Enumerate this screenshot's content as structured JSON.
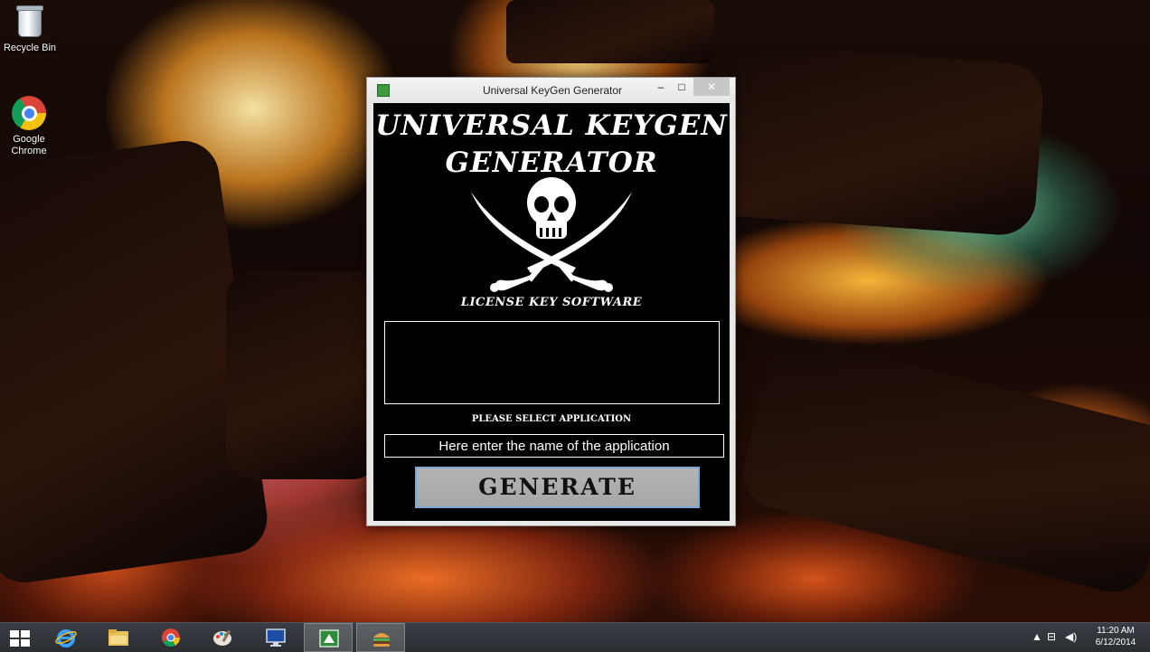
{
  "desktop": {
    "icons": [
      {
        "label": "Recycle Bin",
        "icon": "recycle-bin-icon"
      },
      {
        "label": "Google Chrome",
        "icon": "chrome-icon"
      }
    ]
  },
  "window": {
    "title": "Universal KeyGen Generator",
    "controls": {
      "minimize": "–",
      "maximize": "□",
      "close": "✕"
    },
    "header_line1": "UNIVERSAL KEYGEN",
    "header_line2": "GENERATOR",
    "logo": "skull-crossed-swords-icon",
    "tagline": "LICENSE KEY SOFTWARE",
    "output_value": "",
    "select_label": "PLEASE SELECT APPLICATION",
    "app_input": {
      "placeholder": "Here enter the name of the application",
      "value": ""
    },
    "generate_label": "GENERATE"
  },
  "taskbar": {
    "items": [
      {
        "name": "start",
        "icon": "windows-start-icon"
      },
      {
        "name": "internet-explorer",
        "icon": "ie-icon"
      },
      {
        "name": "file-explorer",
        "icon": "folder-icon"
      },
      {
        "name": "chrome",
        "icon": "chrome-icon"
      },
      {
        "name": "paint",
        "icon": "paint-icon"
      },
      {
        "name": "remote-desktop",
        "icon": "computer-icon"
      },
      {
        "name": "keygen-app",
        "icon": "keygen-app-icon"
      },
      {
        "name": "burger-app",
        "icon": "burger-icon"
      }
    ],
    "tray": {
      "time": "11:20 AM",
      "date": "6/12/2014"
    }
  },
  "colors": {
    "window_bg": "#000000",
    "text": "#ffffff",
    "button_bg": "#a9a9a9",
    "button_border": "#7aa6d6"
  }
}
